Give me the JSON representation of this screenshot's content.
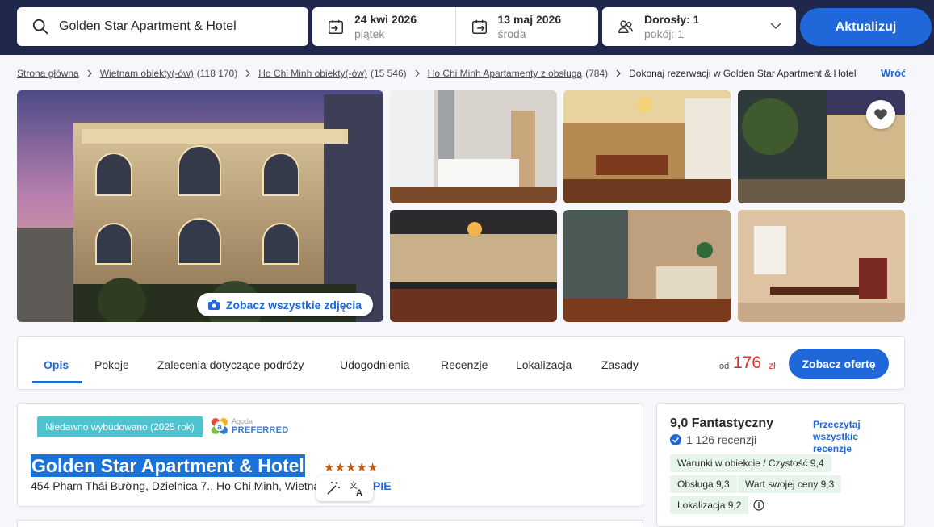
{
  "search": {
    "destination": "Golden Star Apartment & Hotel",
    "checkin_date": "24 kwi 2026",
    "checkin_day": "piątek",
    "checkout_date": "13 maj 2026",
    "checkout_day": "środa",
    "guests": "Dorosły: 1",
    "rooms": "pokój: 1",
    "update_label": "Aktualizuj"
  },
  "breadcrumb": {
    "items": [
      {
        "label": "Strona główna",
        "count": ""
      },
      {
        "label": "Wietnam obiekty(-ów)",
        "count": "(118 170)"
      },
      {
        "label": "Ho Chi Minh obiekty(-ów)",
        "count": "(15 546)"
      },
      {
        "label": "Ho Chi Minh Apartamenty z obsługą",
        "count": "(784)"
      }
    ],
    "current": "Dokonaj rezerwacji w Golden Star Apartment & Hotel",
    "back_label": "Wróć"
  },
  "gallery": {
    "all_photos_label": "Zobacz wszystkie zdjęcia"
  },
  "tabs": {
    "items": [
      "Opis",
      "Pokoje",
      "Zalecenia dotyczące podróży",
      "Udogodnienia",
      "Recenzje",
      "Lokalizacja",
      "Zasady"
    ],
    "price_prefix": "od",
    "price": "176",
    "currency": "zł",
    "offer_label": "Zobacz ofertę"
  },
  "hotel": {
    "badge": "Niedawno wybudowano (2025 rok)",
    "agoda_line1": "Agoda",
    "agoda_line2": "PREFERRED",
    "name": "Golden Star Apartment & Hotel",
    "stars": 5,
    "address": "454 Phạm Thái Bường, Dzielnica 7., Ho Chi Minh, Wietnam",
    "map_label": "PIE"
  },
  "rating": {
    "score_text": "9,0 Fantastyczny",
    "reviews": "1 126 recenzji",
    "read_all": "Przeczytaj wszystkie recenzje",
    "chips": [
      "Warunki w obiekcie / Czystość 9,4",
      "Obsługa 9,3",
      "Wart swojej ceny 9,3",
      "Lokalizacja 9,2"
    ]
  },
  "colors": {
    "topbar": "#20274d",
    "accent": "#2067da",
    "price": "#e12d2d",
    "chip_bg": "#e6f4ea",
    "badge_bg": "#4fc3cf"
  }
}
